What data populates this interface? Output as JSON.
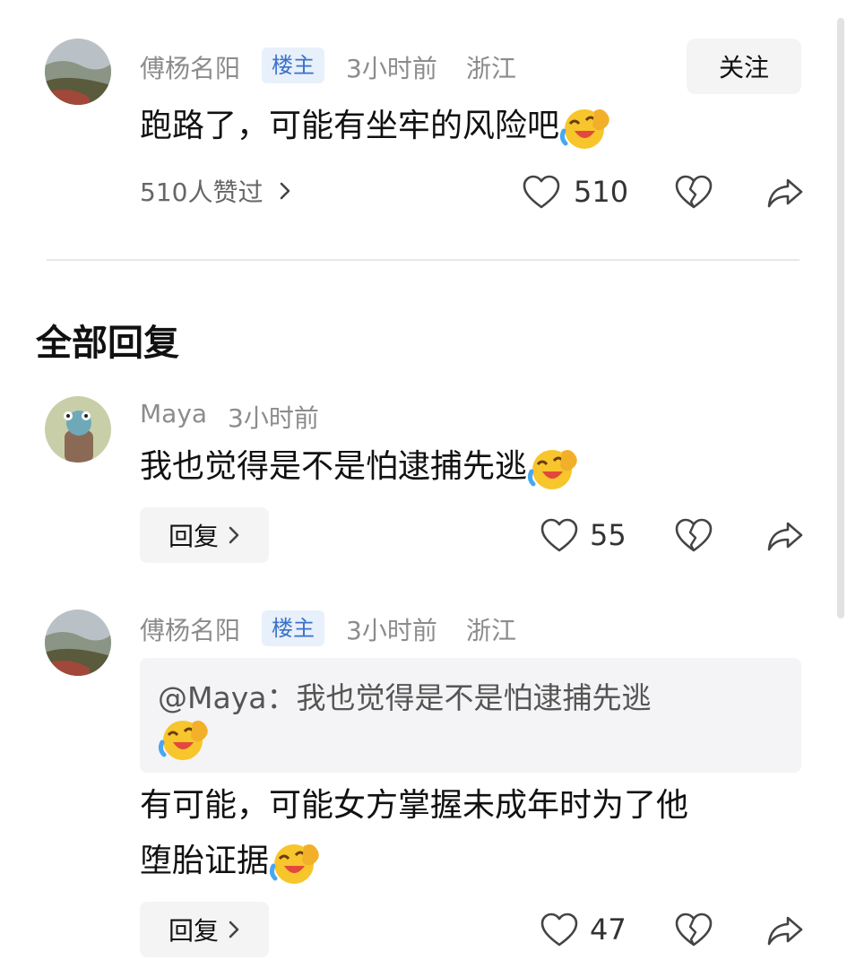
{
  "main_comment": {
    "author": "傅杨名阳",
    "badge": "楼主",
    "time": "3小时前",
    "location": "浙江",
    "follow_label": "关注",
    "text": "跑路了，可能有坐牢的风险吧",
    "liked_by": "510人赞过",
    "likes": "510"
  },
  "replies_section": {
    "title": "全部回复",
    "reply_label": "回复",
    "replies": [
      {
        "author": "Maya",
        "time": "3小时前",
        "text": "我也觉得是不是怕逮捕先逃",
        "likes": "55"
      },
      {
        "author": "傅杨名阳",
        "badge": "楼主",
        "time": "3小时前",
        "location": "浙江",
        "quote": "@Maya：我也觉得是不是怕逮捕先逃",
        "text_line1": "有可能，可能女方掌握未成年时为了他",
        "text_line2": "堕胎证据",
        "likes": "47"
      }
    ]
  },
  "icons": [
    "chevron-right-icon",
    "heart-icon",
    "broken-heart-icon",
    "share-icon",
    "laugh-cry-emoji"
  ],
  "colors": {
    "badge_bg": "#e8f0fb",
    "badge_text": "#3b72c9",
    "meta": "#8c8c8c",
    "button_bg": "#f4f4f5"
  }
}
